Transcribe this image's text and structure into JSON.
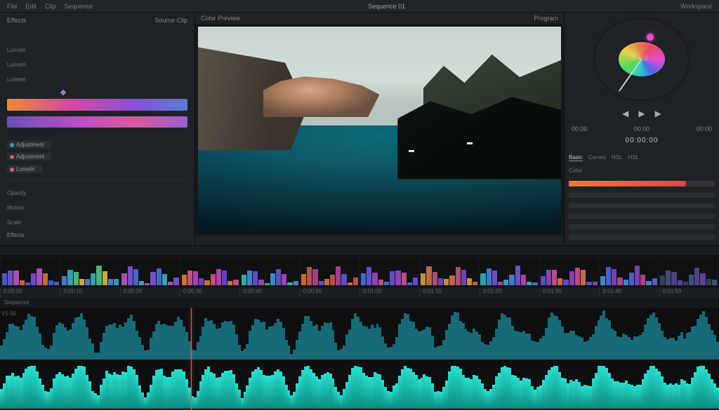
{
  "topbar": {
    "menu": [
      "File",
      "Edit",
      "Clip",
      "Sequence"
    ],
    "title": "Sequence 01",
    "right": "Workspace"
  },
  "left": {
    "header_left": "Effects",
    "header_right": "Source Clip",
    "list_items": [
      "Lumetri",
      "Lumetri",
      "Lumetri"
    ],
    "clip_rows": [
      {
        "dot": "blue",
        "label": "Adjustment"
      },
      {
        "dot": "red",
        "label": "Adjustment"
      },
      {
        "dot": "pink",
        "label": "Lumetri"
      }
    ],
    "text_rows": [
      "Opacity",
      "Motion",
      "Scale"
    ],
    "bottom_label": "Effects"
  },
  "viewer": {
    "tab_left": "Color Preview",
    "tab_right": "Program"
  },
  "right": {
    "wheel_value": "0.85",
    "tc_left": "00:00",
    "tc_right": "00:00",
    "tc_side": "00:00",
    "timecode": "00:00:00",
    "tabs": [
      "Basic",
      "Curves",
      "HSL",
      "HSL"
    ],
    "label": "Color"
  },
  "timeline": {
    "timecodes": [
      "0:00:00",
      "0:00:10",
      "0:00:20",
      "0:00:30",
      "0:00:40",
      "0:00:50",
      "0:01:00",
      "0:01:10",
      "0:01:20",
      "0:01:30",
      "0:01:40",
      "0:01:50"
    ],
    "track_label": "Sequence",
    "side_top": "V1 00",
    "side_bottom": "A1 00"
  },
  "colors": {
    "thumb_palettes": [
      [
        "#4a6ae8",
        "#7a5ae8",
        "#c85ad0",
        "#e87a3a"
      ],
      [
        "#5a8ae8",
        "#3ab8d0",
        "#58d088",
        "#e8c44a"
      ],
      [
        "#c85ad0",
        "#8a5ae8",
        "#4a7ae8",
        "#3ac0d0"
      ],
      [
        "#e88a3a",
        "#e85a8a",
        "#c84ad0",
        "#7a4ae8"
      ],
      [
        "#3ac8c0",
        "#4a9ae8",
        "#6a5ae8",
        "#b84ad0"
      ],
      [
        "#e87a3a",
        "#d85a5a",
        "#b84aa0",
        "#6a5ae8"
      ],
      [
        "#4a7ae8",
        "#6a5ae8",
        "#a84ad0",
        "#d85a9a"
      ],
      [
        "#e8a44a",
        "#d87a4a",
        "#c85a8a",
        "#8a4ad0"
      ],
      [
        "#3ab8d0",
        "#4a8ae8",
        "#7a5ae8",
        "#c84ac0"
      ],
      [
        "#6a5ae8",
        "#9a4ad0",
        "#d05a9a",
        "#e87a5a"
      ],
      [
        "#4a9ae8",
        "#5a6ae8",
        "#8a4ad0",
        "#c84aa0"
      ],
      [
        "#3a4a6a",
        "#4a5a8a",
        "#5a4a9a",
        "#6a4ab0"
      ]
    ]
  }
}
